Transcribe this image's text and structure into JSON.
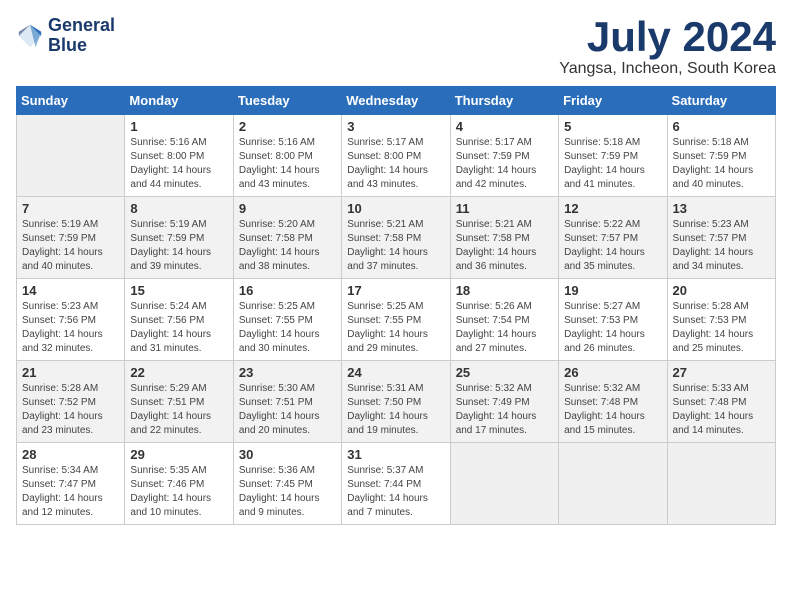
{
  "logo": {
    "line1": "General",
    "line2": "Blue"
  },
  "title": "July 2024",
  "subtitle": "Yangsa, Incheon, South Korea",
  "days_of_week": [
    "Sunday",
    "Monday",
    "Tuesday",
    "Wednesday",
    "Thursday",
    "Friday",
    "Saturday"
  ],
  "weeks": [
    [
      {
        "day": "",
        "sunrise": "",
        "sunset": "",
        "daylight": ""
      },
      {
        "day": "1",
        "sunrise": "Sunrise: 5:16 AM",
        "sunset": "Sunset: 8:00 PM",
        "daylight": "Daylight: 14 hours and 44 minutes."
      },
      {
        "day": "2",
        "sunrise": "Sunrise: 5:16 AM",
        "sunset": "Sunset: 8:00 PM",
        "daylight": "Daylight: 14 hours and 43 minutes."
      },
      {
        "day": "3",
        "sunrise": "Sunrise: 5:17 AM",
        "sunset": "Sunset: 8:00 PM",
        "daylight": "Daylight: 14 hours and 43 minutes."
      },
      {
        "day": "4",
        "sunrise": "Sunrise: 5:17 AM",
        "sunset": "Sunset: 7:59 PM",
        "daylight": "Daylight: 14 hours and 42 minutes."
      },
      {
        "day": "5",
        "sunrise": "Sunrise: 5:18 AM",
        "sunset": "Sunset: 7:59 PM",
        "daylight": "Daylight: 14 hours and 41 minutes."
      },
      {
        "day": "6",
        "sunrise": "Sunrise: 5:18 AM",
        "sunset": "Sunset: 7:59 PM",
        "daylight": "Daylight: 14 hours and 40 minutes."
      }
    ],
    [
      {
        "day": "7",
        "sunrise": "Sunrise: 5:19 AM",
        "sunset": "Sunset: 7:59 PM",
        "daylight": "Daylight: 14 hours and 40 minutes."
      },
      {
        "day": "8",
        "sunrise": "Sunrise: 5:19 AM",
        "sunset": "Sunset: 7:59 PM",
        "daylight": "Daylight: 14 hours and 39 minutes."
      },
      {
        "day": "9",
        "sunrise": "Sunrise: 5:20 AM",
        "sunset": "Sunset: 7:58 PM",
        "daylight": "Daylight: 14 hours and 38 minutes."
      },
      {
        "day": "10",
        "sunrise": "Sunrise: 5:21 AM",
        "sunset": "Sunset: 7:58 PM",
        "daylight": "Daylight: 14 hours and 37 minutes."
      },
      {
        "day": "11",
        "sunrise": "Sunrise: 5:21 AM",
        "sunset": "Sunset: 7:58 PM",
        "daylight": "Daylight: 14 hours and 36 minutes."
      },
      {
        "day": "12",
        "sunrise": "Sunrise: 5:22 AM",
        "sunset": "Sunset: 7:57 PM",
        "daylight": "Daylight: 14 hours and 35 minutes."
      },
      {
        "day": "13",
        "sunrise": "Sunrise: 5:23 AM",
        "sunset": "Sunset: 7:57 PM",
        "daylight": "Daylight: 14 hours and 34 minutes."
      }
    ],
    [
      {
        "day": "14",
        "sunrise": "Sunrise: 5:23 AM",
        "sunset": "Sunset: 7:56 PM",
        "daylight": "Daylight: 14 hours and 32 minutes."
      },
      {
        "day": "15",
        "sunrise": "Sunrise: 5:24 AM",
        "sunset": "Sunset: 7:56 PM",
        "daylight": "Daylight: 14 hours and 31 minutes."
      },
      {
        "day": "16",
        "sunrise": "Sunrise: 5:25 AM",
        "sunset": "Sunset: 7:55 PM",
        "daylight": "Daylight: 14 hours and 30 minutes."
      },
      {
        "day": "17",
        "sunrise": "Sunrise: 5:25 AM",
        "sunset": "Sunset: 7:55 PM",
        "daylight": "Daylight: 14 hours and 29 minutes."
      },
      {
        "day": "18",
        "sunrise": "Sunrise: 5:26 AM",
        "sunset": "Sunset: 7:54 PM",
        "daylight": "Daylight: 14 hours and 27 minutes."
      },
      {
        "day": "19",
        "sunrise": "Sunrise: 5:27 AM",
        "sunset": "Sunset: 7:53 PM",
        "daylight": "Daylight: 14 hours and 26 minutes."
      },
      {
        "day": "20",
        "sunrise": "Sunrise: 5:28 AM",
        "sunset": "Sunset: 7:53 PM",
        "daylight": "Daylight: 14 hours and 25 minutes."
      }
    ],
    [
      {
        "day": "21",
        "sunrise": "Sunrise: 5:28 AM",
        "sunset": "Sunset: 7:52 PM",
        "daylight": "Daylight: 14 hours and 23 minutes."
      },
      {
        "day": "22",
        "sunrise": "Sunrise: 5:29 AM",
        "sunset": "Sunset: 7:51 PM",
        "daylight": "Daylight: 14 hours and 22 minutes."
      },
      {
        "day": "23",
        "sunrise": "Sunrise: 5:30 AM",
        "sunset": "Sunset: 7:51 PM",
        "daylight": "Daylight: 14 hours and 20 minutes."
      },
      {
        "day": "24",
        "sunrise": "Sunrise: 5:31 AM",
        "sunset": "Sunset: 7:50 PM",
        "daylight": "Daylight: 14 hours and 19 minutes."
      },
      {
        "day": "25",
        "sunrise": "Sunrise: 5:32 AM",
        "sunset": "Sunset: 7:49 PM",
        "daylight": "Daylight: 14 hours and 17 minutes."
      },
      {
        "day": "26",
        "sunrise": "Sunrise: 5:32 AM",
        "sunset": "Sunset: 7:48 PM",
        "daylight": "Daylight: 14 hours and 15 minutes."
      },
      {
        "day": "27",
        "sunrise": "Sunrise: 5:33 AM",
        "sunset": "Sunset: 7:48 PM",
        "daylight": "Daylight: 14 hours and 14 minutes."
      }
    ],
    [
      {
        "day": "28",
        "sunrise": "Sunrise: 5:34 AM",
        "sunset": "Sunset: 7:47 PM",
        "daylight": "Daylight: 14 hours and 12 minutes."
      },
      {
        "day": "29",
        "sunrise": "Sunrise: 5:35 AM",
        "sunset": "Sunset: 7:46 PM",
        "daylight": "Daylight: 14 hours and 10 minutes."
      },
      {
        "day": "30",
        "sunrise": "Sunrise: 5:36 AM",
        "sunset": "Sunset: 7:45 PM",
        "daylight": "Daylight: 14 hours and 9 minutes."
      },
      {
        "day": "31",
        "sunrise": "Sunrise: 5:37 AM",
        "sunset": "Sunset: 7:44 PM",
        "daylight": "Daylight: 14 hours and 7 minutes."
      },
      {
        "day": "",
        "sunrise": "",
        "sunset": "",
        "daylight": ""
      },
      {
        "day": "",
        "sunrise": "",
        "sunset": "",
        "daylight": ""
      },
      {
        "day": "",
        "sunrise": "",
        "sunset": "",
        "daylight": ""
      }
    ]
  ]
}
